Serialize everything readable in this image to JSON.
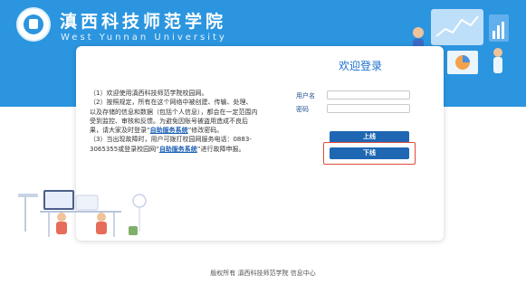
{
  "header": {
    "school_name_cn": "滇西科技师范学院",
    "school_name_en": "West Yunnan University"
  },
  "notice": {
    "p1": "（1）欢迎使用滇西科技师范学院校园网。",
    "p2_a": "（2）按照规定，所有在这个网络中被创建、传输、处理、以及存储的信息和数据（包括个人信息），都会在一定范围内受到监控、审核和反馈。为避免因账号被盗用造成不良后果，请大家及时登录“",
    "p2_link": "自助服务系统",
    "p2_b": "”修改密码。",
    "p3_a": "（3）当出现故障时，用户可拨打校园网服务电话：0883-3065355或登录校园网“",
    "p3_link": "自助服务系统",
    "p3_b": "”进行故障申报。"
  },
  "login": {
    "title": "欢迎登录",
    "username_label": "用户名",
    "password_label": "密码",
    "username_value": "",
    "password_value": "",
    "login_button": "上线",
    "logout_button": "下线"
  },
  "footer": {
    "text": "版权所有  滇西科技师范学院  信息中心"
  },
  "colors": {
    "banner": "#2b95df",
    "button": "#1f67b3",
    "title": "#1c6fcf",
    "highlight": "#e24b3c"
  }
}
